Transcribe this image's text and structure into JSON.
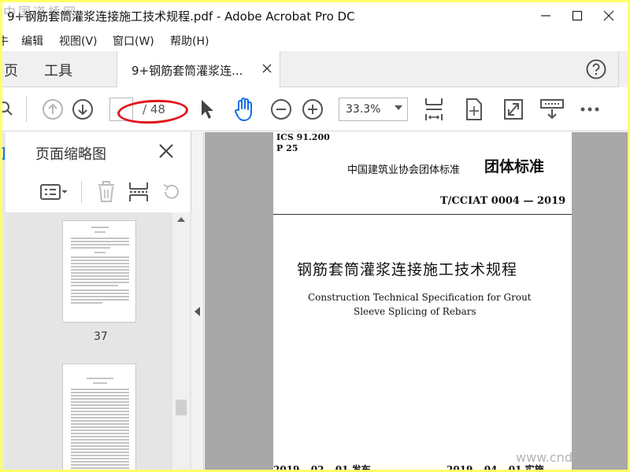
{
  "window": {
    "title": "9+钢筋套筒灌浆连接施工技术规程.pdf - Adobe Acrobat Pro DC"
  },
  "menu": {
    "partial": "牛",
    "items": [
      "编辑",
      "视图(V)",
      "窗口(W)",
      "帮助(H)"
    ]
  },
  "tabs": {
    "home": "页",
    "tools": "工具",
    "document": "9+钢筋套筒灌浆连..."
  },
  "toolbar": {
    "page_current": "",
    "page_total": "/ 48",
    "zoom": "33.3%"
  },
  "panel": {
    "title": "页面缩略图",
    "thumbnail_labels": [
      "37"
    ]
  },
  "document": {
    "ics": "ICS 91.200",
    "p_code": "P 25",
    "association": "中国建筑业协会团体标准",
    "standard_type": "团体标准",
    "standard_number": "T/CCIAT 0004 — 2019",
    "title_cn": "钢筋套筒灌浆连接施工技术规程",
    "title_en_line1": "Construction Technical Specification for Grout",
    "title_en_line2": "Sleeve Splicing of Rebars",
    "date_issue": "2019 – 02 – 01   发布",
    "date_implement": "2019 – 04 – 01   实施"
  },
  "watermarks": {
    "top": "中国道桥网",
    "bottom": "www.cnd"
  },
  "colors": {
    "accent_blue": "#1473e6",
    "annotation_red": "#e0161b",
    "screenshot_border": "#ffff66"
  }
}
